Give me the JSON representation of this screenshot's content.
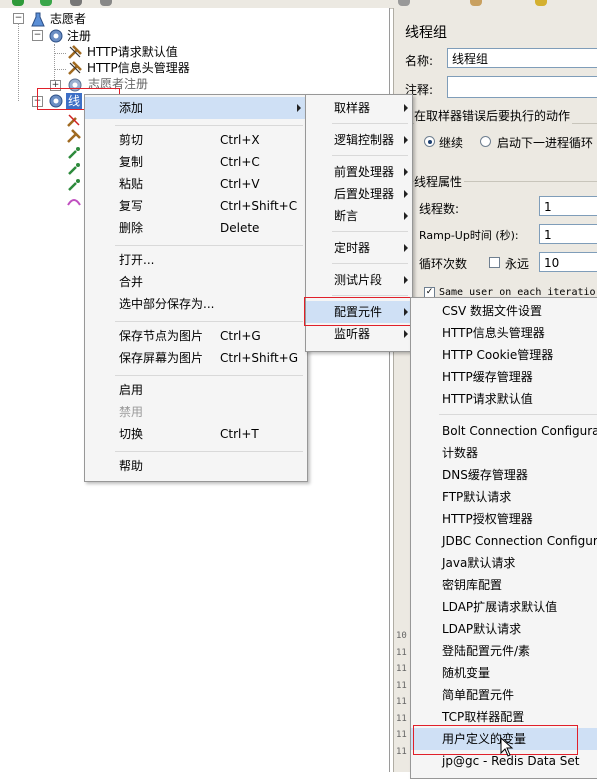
{
  "tree": {
    "root_label": "志愿者",
    "items": [
      {
        "label": "注册",
        "icon": "gear-icon"
      },
      {
        "label": "HTTP请求默认值",
        "icon": "wrench-icon"
      },
      {
        "label": "HTTP信息头管理器",
        "icon": "wrench-icon"
      },
      {
        "label": "志愿者注册",
        "icon": "gear-icon"
      },
      {
        "label": "线",
        "icon": "gear-icon"
      }
    ]
  },
  "right_panel": {
    "title": "线程组",
    "name_label": "名称:",
    "name_value": "线程组",
    "comment_label": "注释:",
    "error_section": "在取样器错误后要执行的动作",
    "radio_continue": "继续",
    "radio_next_loop": "启动下一进程循环",
    "thread_props": "线程属性",
    "threads_label": "线程数:",
    "threads_value": "1",
    "rampup_label": "Ramp-Up时间 (秒):",
    "rampup_value": "1",
    "loop_label": "循环次数",
    "forever_label": "永远",
    "loop_value": "10",
    "same_user_label": "Same user on each iteratio"
  },
  "log_lines": [
    "10",
    "11",
    "11",
    "11",
    "11",
    "11",
    "11",
    "11"
  ],
  "context_menu": {
    "items": [
      {
        "label": "添加",
        "shortcut": "",
        "submenu": true
      },
      {
        "label": "剪切",
        "shortcut": "Ctrl+X"
      },
      {
        "label": "复制",
        "shortcut": "Ctrl+C"
      },
      {
        "label": "粘贴",
        "shortcut": "Ctrl+V"
      },
      {
        "label": "复写",
        "shortcut": "Ctrl+Shift+C"
      },
      {
        "label": "删除",
        "shortcut": "Delete"
      },
      {
        "label": "打开...",
        "shortcut": ""
      },
      {
        "label": "合并",
        "shortcut": ""
      },
      {
        "label": "选中部分保存为...",
        "shortcut": ""
      },
      {
        "label": "保存节点为图片",
        "shortcut": "Ctrl+G"
      },
      {
        "label": "保存屏幕为图片",
        "shortcut": "Ctrl+Shift+G"
      },
      {
        "label": "启用",
        "shortcut": ""
      },
      {
        "label": "禁用",
        "shortcut": "",
        "disabled": true
      },
      {
        "label": "切换",
        "shortcut": "Ctrl+T"
      },
      {
        "label": "帮助",
        "shortcut": ""
      }
    ]
  },
  "add_submenu": {
    "items": [
      "取样器",
      "逻辑控制器",
      "前置处理器",
      "后置处理器",
      "断言",
      "定时器",
      "测试片段",
      "配置元件",
      "监听器"
    ]
  },
  "config_submenu": {
    "items": [
      "CSV 数据文件设置",
      "HTTP信息头管理器",
      "HTTP Cookie管理器",
      "HTTP缓存管理器",
      "HTTP请求默认值",
      "Bolt Connection Configurat",
      "计数器",
      "DNS缓存管理器",
      "FTP默认请求",
      "HTTP授权管理器",
      "JDBC Connection Configura",
      "Java默认请求",
      "密钥库配置",
      "LDAP扩展请求默认值",
      "LDAP默认请求",
      "登陆配置元件/素",
      "随机变量",
      "简单配置元件",
      "TCP取样器配置",
      "用户定义的变量",
      "jp@gc - Redis Data Set"
    ]
  },
  "colors": {
    "highlight_border": "#e0202a",
    "menu_bg": "#f5f5f5",
    "panel_bg": "#ece9e2"
  }
}
